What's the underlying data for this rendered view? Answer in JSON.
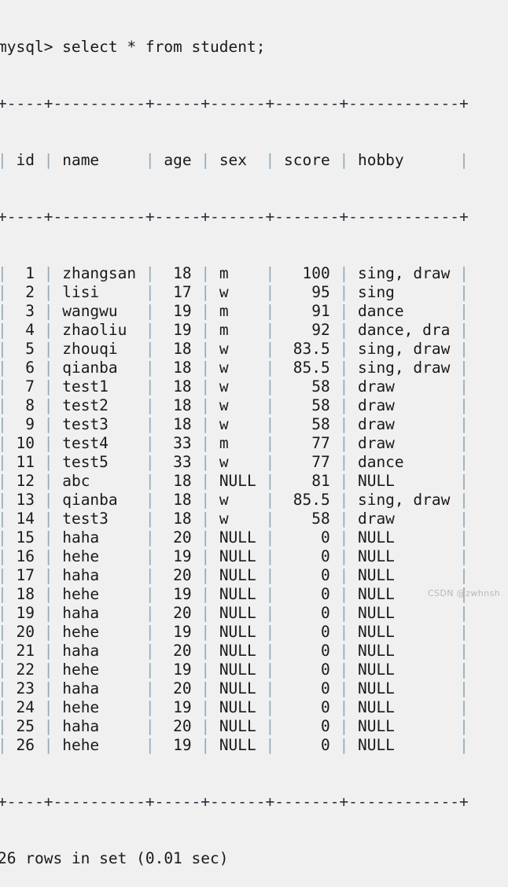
{
  "terminal": {
    "prompt": "mysql>",
    "command": "select * from student;",
    "prompt_line": "mysql> select * from student;",
    "result_status": "26 rows in set (0.01 sec)",
    "separator": "+----+----------+-----+------+-------+------------+",
    "background_color": "#f0f0f0",
    "text_color": "#1a1a1a",
    "pipe_color": "#8fa9bd"
  },
  "watermark": {
    "text": "CSDN @zwhnsh",
    "color": "#b8b8b8"
  },
  "table": {
    "name": "student",
    "columns": [
      {
        "key": "id",
        "label": "id",
        "width": 4,
        "align": "right"
      },
      {
        "key": "name",
        "label": "name",
        "width": 10,
        "align": "left"
      },
      {
        "key": "age",
        "label": "age",
        "width": 5,
        "align": "right"
      },
      {
        "key": "sex",
        "label": "sex",
        "width": 6,
        "align": "left"
      },
      {
        "key": "score",
        "label": "score",
        "width": 7,
        "align": "right"
      },
      {
        "key": "hobby",
        "label": "hobby",
        "width": 12,
        "align": "left"
      }
    ],
    "row_count": 26,
    "rows": [
      {
        "id": "1",
        "name": "zhangsan",
        "age": "18",
        "sex": "m",
        "score": "100",
        "hobby": "sing, draw"
      },
      {
        "id": "2",
        "name": "lisi",
        "age": "17",
        "sex": "w",
        "score": "95",
        "hobby": "sing"
      },
      {
        "id": "3",
        "name": "wangwu",
        "age": "19",
        "sex": "m",
        "score": "91",
        "hobby": "dance"
      },
      {
        "id": "4",
        "name": "zhaoliu",
        "age": "19",
        "sex": "m",
        "score": "92",
        "hobby": "dance, draw"
      },
      {
        "id": "5",
        "name": "zhouqi",
        "age": "18",
        "sex": "w",
        "score": "83.5",
        "hobby": "sing, draw"
      },
      {
        "id": "6",
        "name": "qianba",
        "age": "18",
        "sex": "w",
        "score": "85.5",
        "hobby": "sing, draw"
      },
      {
        "id": "7",
        "name": "test1",
        "age": "18",
        "sex": "w",
        "score": "58",
        "hobby": "draw"
      },
      {
        "id": "8",
        "name": "test2",
        "age": "18",
        "sex": "w",
        "score": "58",
        "hobby": "draw"
      },
      {
        "id": "9",
        "name": "test3",
        "age": "18",
        "sex": "w",
        "score": "58",
        "hobby": "draw"
      },
      {
        "id": "10",
        "name": "test4",
        "age": "33",
        "sex": "m",
        "score": "77",
        "hobby": "draw"
      },
      {
        "id": "11",
        "name": "test5",
        "age": "33",
        "sex": "w",
        "score": "77",
        "hobby": "dance"
      },
      {
        "id": "12",
        "name": "abc",
        "age": "18",
        "sex": "NULL",
        "score": "81",
        "hobby": "NULL"
      },
      {
        "id": "13",
        "name": "qianba",
        "age": "18",
        "sex": "w",
        "score": "85.5",
        "hobby": "sing, draw"
      },
      {
        "id": "14",
        "name": "test3",
        "age": "18",
        "sex": "w",
        "score": "58",
        "hobby": "draw"
      },
      {
        "id": "15",
        "name": "haha",
        "age": "20",
        "sex": "NULL",
        "score": "0",
        "hobby": "NULL"
      },
      {
        "id": "16",
        "name": "hehe",
        "age": "19",
        "sex": "NULL",
        "score": "0",
        "hobby": "NULL"
      },
      {
        "id": "17",
        "name": "haha",
        "age": "20",
        "sex": "NULL",
        "score": "0",
        "hobby": "NULL"
      },
      {
        "id": "18",
        "name": "hehe",
        "age": "19",
        "sex": "NULL",
        "score": "0",
        "hobby": "NULL"
      },
      {
        "id": "19",
        "name": "haha",
        "age": "20",
        "sex": "NULL",
        "score": "0",
        "hobby": "NULL"
      },
      {
        "id": "20",
        "name": "hehe",
        "age": "19",
        "sex": "NULL",
        "score": "0",
        "hobby": "NULL"
      },
      {
        "id": "21",
        "name": "haha",
        "age": "20",
        "sex": "NULL",
        "score": "0",
        "hobby": "NULL"
      },
      {
        "id": "22",
        "name": "hehe",
        "age": "19",
        "sex": "NULL",
        "score": "0",
        "hobby": "NULL"
      },
      {
        "id": "23",
        "name": "haha",
        "age": "20",
        "sex": "NULL",
        "score": "0",
        "hobby": "NULL"
      },
      {
        "id": "24",
        "name": "hehe",
        "age": "19",
        "sex": "NULL",
        "score": "0",
        "hobby": "NULL"
      },
      {
        "id": "25",
        "name": "haha",
        "age": "20",
        "sex": "NULL",
        "score": "0",
        "hobby": "NULL"
      },
      {
        "id": "26",
        "name": "hehe",
        "age": "19",
        "sex": "NULL",
        "score": "0",
        "hobby": "NULL"
      }
    ]
  }
}
